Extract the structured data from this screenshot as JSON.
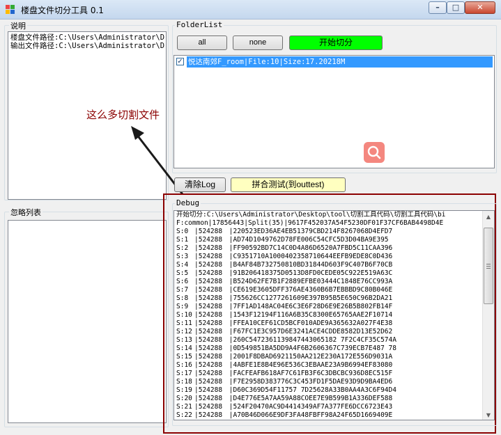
{
  "window": {
    "title": "楼盘文件切分工具 0.1",
    "minimize_glyph": "–",
    "maximize_glyph": "□",
    "close_glyph": "✕"
  },
  "description_group": {
    "label": "说明",
    "lines": [
      "楼盘文件路径:C:\\Users\\Administrator\\D",
      "输出文件路径:C:\\Users\\Administrator\\D"
    ]
  },
  "ignore_group": {
    "label": "忽略列表"
  },
  "folder_list": {
    "label": "FolderList",
    "all_label": "all",
    "none_label": "none",
    "start_label": "开始切分",
    "items": [
      {
        "text": "悦达南郊F_room|File:10|Size:17.20218M",
        "checked": true
      }
    ]
  },
  "annotation": {
    "text": "这么多切割文件",
    "color": "#8b0000"
  },
  "clear_log_label": "清除Log",
  "merge_test_label": "拼合测试(到outtest)",
  "debug": {
    "label": "Debug",
    "header_lines": [
      "开始切分:C:\\Users\\Administrator\\Desktop\\tool\\切割工具代码\\切割工具代码\\bi",
      "F:common|17856443|Split(35)|9617F452037A54F5230DF01F37CF6BAB4498D4E"
    ],
    "rows": [
      {
        "idx": "S:0",
        "size": "524288",
        "hash": "220523ED36AE4EB51379CBD214F8267068D4EFD7"
      },
      {
        "idx": "S:1",
        "size": "524288",
        "hash": "AD74D1049762D78FE006C54CFC5D3D04BA9E395"
      },
      {
        "idx": "S:2",
        "size": "524288",
        "hash": "FF90592BD7C14C0D4A86D6520A7FBD5C11CAA396"
      },
      {
        "idx": "S:3",
        "size": "524288",
        "hash": "C9351710A1000402358710644EEFB9EDE8C0D436"
      },
      {
        "idx": "S:4",
        "size": "524288",
        "hash": "B4AF84B732750810BD31844D603F9C407B6F70CB"
      },
      {
        "idx": "S:5",
        "size": "524288",
        "hash": "91B206418375D0513D8FD0CEDE05C922E519A63C"
      },
      {
        "idx": "S:6",
        "size": "524288",
        "hash": "B524D62FE7B1F2889EFBE03444C1848E76CC993A"
      },
      {
        "idx": "S:7",
        "size": "524288",
        "hash": "CE619E3605DFF376AE4360B6B7EBBBD9C80B046E"
      },
      {
        "idx": "S:8",
        "size": "524288",
        "hash": "755626CC1277261609E397B95B5E650C96B2DA21"
      },
      {
        "idx": "S:9",
        "size": "524288",
        "hash": "7FF1AD148AC04E6C3E6F28D6E9E26B5B802FB14F"
      },
      {
        "idx": "S:10",
        "size": "524288",
        "hash": "1543F12194F116A6B35C8300E65765AAE2F10714"
      },
      {
        "idx": "S:11",
        "size": "524288",
        "hash": "FFEA10CEF61CD5BCF010ADE9A365632A027F4E38"
      },
      {
        "idx": "S:12",
        "size": "524288",
        "hash": "F67FC1E3C957D6E3241ACE4CDDE8582D13E52D62"
      },
      {
        "idx": "S:13",
        "size": "524288",
        "hash": "260C5472361139847443065182 7F2C4CF35C574A"
      },
      {
        "idx": "S:14",
        "size": "524288",
        "hash": "0D549851BA5DD9A4F6B2606367C739ECB7E487 78"
      },
      {
        "idx": "S:15",
        "size": "524288",
        "hash": "2001F8DBAD6921150AA212E230A172E556D9031A"
      },
      {
        "idx": "S:16",
        "size": "524288",
        "hash": "4ABFE1E8B4E96E536C3EBAAE23A9B6994EF83080"
      },
      {
        "idx": "S:17",
        "size": "524288",
        "hash": "FACFEAFB618AF7C61FB3F6C3DBCBC936D8EC515F"
      },
      {
        "idx": "S:18",
        "size": "524288",
        "hash": "F7E2958D383776C3C453FD1F5DAE93D9D9BA4ED6"
      },
      {
        "idx": "S:19",
        "size": "524288",
        "hash": "D60C369D54F11757 7D25628A33B0AA4A3C6F94D4"
      },
      {
        "idx": "S:20",
        "size": "524288",
        "hash": "D4E776E5A7AA59A88COEE7E9B599B1A336DEF588"
      },
      {
        "idx": "S:21",
        "size": "524288",
        "hash": "524F20470AC9D4414349AF7A377FE6DCC6723E43"
      },
      {
        "idx": "S:22",
        "size": "524288",
        "hash": "A70B46D066E9DF3FA48FBFF98A24F65D1669409E"
      }
    ]
  },
  "colors": {
    "start_button": "#00ff00",
    "merge_button": "#ffffc0",
    "selection": "#3399ff",
    "debug_border": "#8b0000",
    "search_fab": "#f4877f"
  },
  "icons": {
    "search_fab": "search-icon",
    "arrow": "arrow-annotation"
  }
}
